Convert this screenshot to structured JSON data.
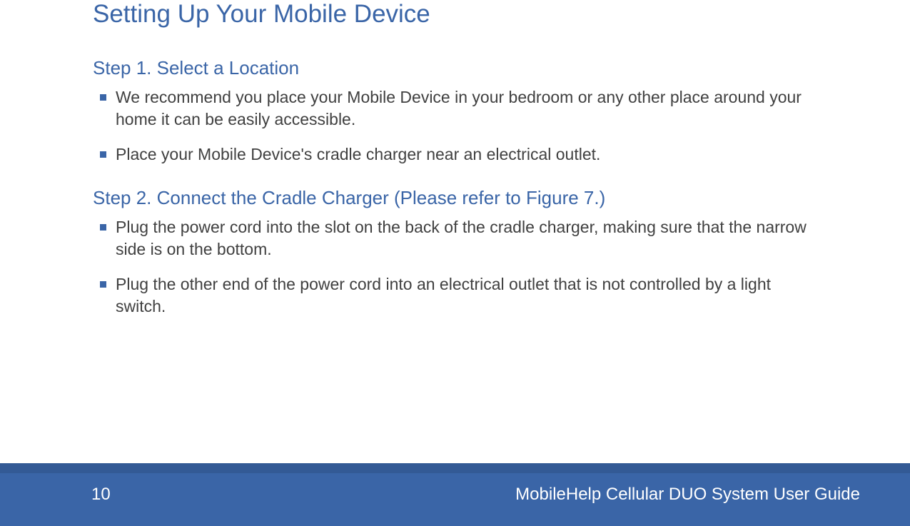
{
  "title": "Setting Up Your Mobile Device",
  "step1": {
    "heading": "Step 1. Select a Location",
    "bullets": [
      "We recommend you place your Mobile Device in your bedroom or any other place around your home it can be easily accessible.",
      "Place your Mobile Device's cradle charger near an electrical outlet."
    ]
  },
  "step2": {
    "heading": "Step 2. Connect the Cradle Charger (Please refer to Figure 7.)",
    "bullets": [
      "Plug the power cord into the slot on the back of the cradle charger, making sure that the narrow side is on the bottom.",
      "Plug the other end of the power cord into an electrical outlet that is not controlled by a light switch."
    ]
  },
  "footer": {
    "page_number": "10",
    "guide_title": "MobileHelp Cellular DUO System User Guide"
  }
}
